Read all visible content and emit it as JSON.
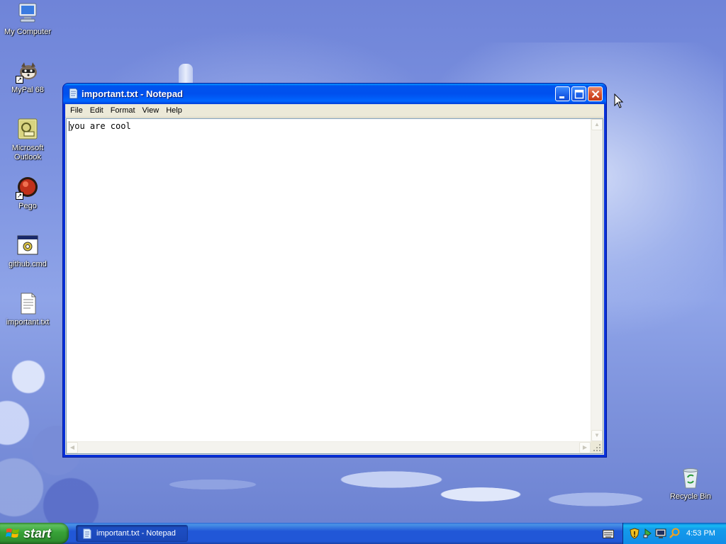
{
  "desktop": {
    "icons": [
      {
        "label": "My Computer",
        "icon": "my-computer-icon"
      },
      {
        "label": "MyPal 68",
        "icon": "mypal-icon"
      },
      {
        "label": "Microsoft Outlook",
        "icon": "outlook-icon"
      },
      {
        "label": "Pego",
        "icon": "pego-icon"
      },
      {
        "label": "github.cmd",
        "icon": "cmd-file-icon"
      },
      {
        "label": "important.txt",
        "icon": "text-file-icon"
      },
      {
        "label": "Recycle Bin",
        "icon": "recycle-bin-icon"
      }
    ]
  },
  "notepad": {
    "title": "important.txt - Notepad",
    "menu": [
      "File",
      "Edit",
      "Format",
      "View",
      "Help"
    ],
    "content": "you are cool"
  },
  "taskbar": {
    "start_label": "start",
    "task_label": "important.txt - Notepad",
    "clock": "4:53 PM"
  },
  "colors": {
    "titlebar": "#0053ee",
    "taskbar": "#2157d7",
    "start_button": "#37a237",
    "tray": "#139beb",
    "close_button": "#d6502c"
  }
}
